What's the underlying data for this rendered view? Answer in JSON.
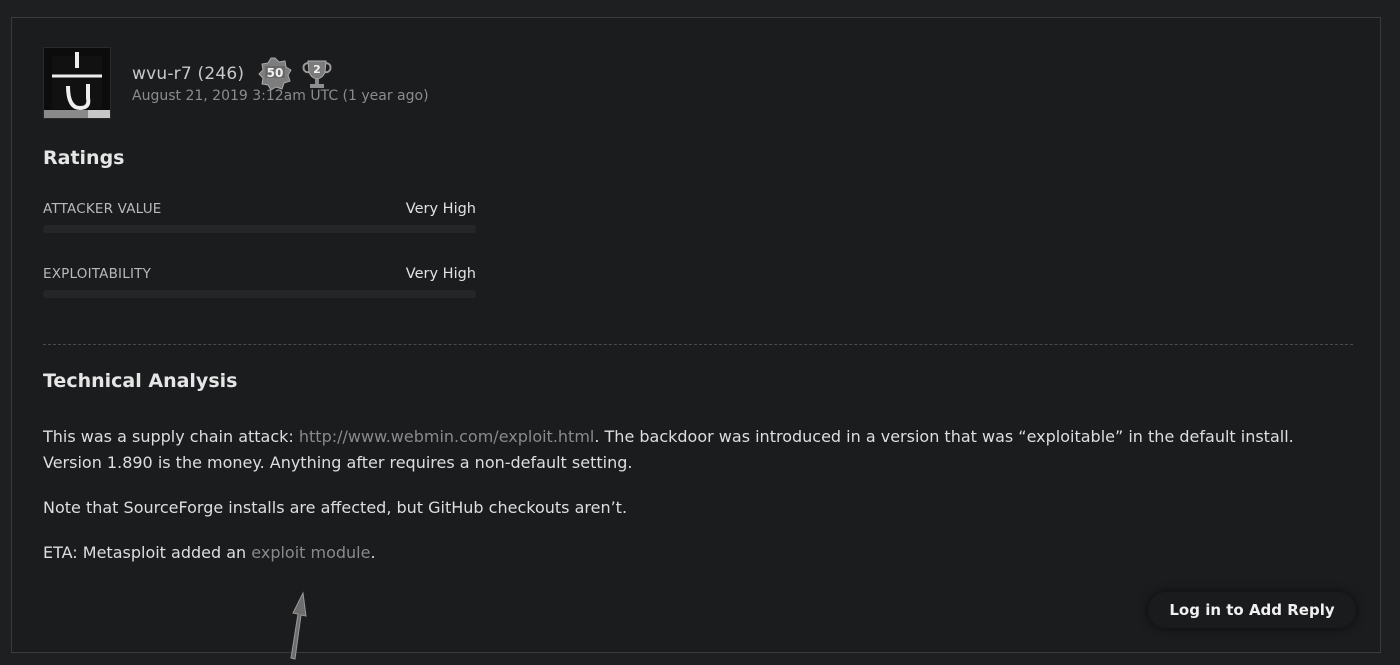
{
  "post": {
    "username": "wvu-r7 (246)",
    "badges": [
      {
        "icon": "ribbon-badge-icon",
        "text": "50"
      },
      {
        "icon": "trophy-badge-icon",
        "text": "2"
      }
    ],
    "timestamp": "August 21, 2019 3:12am UTC (1 year ago)"
  },
  "ratings": {
    "title": "Ratings",
    "items": [
      {
        "label": "ATTACKER VALUE",
        "value": "Very High",
        "level": 1.0
      },
      {
        "label": "EXPLOITABILITY",
        "value": "Very High",
        "level": 1.0
      }
    ]
  },
  "analysis": {
    "title": "Technical Analysis",
    "p1_before": "This was a supply chain attack: ",
    "p1_link": "http://www.webmin.com/exploit.html",
    "p1_after": ". The backdoor was introduced in a version that was “exploitable” in the default install. Version 1.890 is the money. Anything after requires a non-default setting.",
    "p2": "Note that SourceForge installs are affected, but GitHub checkouts aren’t.",
    "p3_before": "ETA: Metasploit added an ",
    "p3_link": "exploit module",
    "p3_after": "."
  },
  "actions": {
    "reply_label": "Log in to Add Reply"
  },
  "colors": {
    "background": "#1e1f21",
    "card": "#1b1c1e",
    "link": "#8a8a8a"
  }
}
